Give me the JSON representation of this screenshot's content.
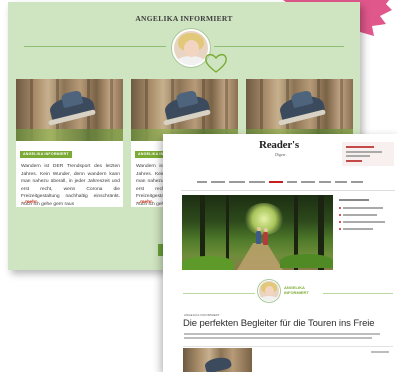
{
  "colors": {
    "accent_pink": "#e0578b",
    "panel_green": "#cfe4c0",
    "badge_green": "#7bab34",
    "more_red": "#c4381d",
    "nav_active_red": "#c81e1e"
  },
  "section": {
    "title": "ANGELIKA INFORMIERT"
  },
  "cards": [
    {
      "badge": "ANGELIKA INFORMIERT",
      "text": "Wandern ist DER Trendsport des letzten Jahres. Kein Wunder, denn wandern kann man nahezu überall, in jeder Jahreszeit und erst recht, wenn Corona die Freizeitgestaltung nachhaltig einschränkt. Auch ich gehe gern raus",
      "more": "...mehr"
    },
    {
      "badge": "ANGELIKA INFORMIERT",
      "text": "Wandern ist DER Trendsport des letzten Jahres. Kein Wunder, denn wandern kann man nahezu überall, in jeder Jahreszeit und erst recht, wenn Corona die Freizeitgestaltung nachhaltig einschränkt. Auch ich gehe gern raus",
      "more": "...mehr"
    },
    {
      "badge": "ANGELIKA INFORMIERT",
      "text": "Wandern ist DER Trendsport des letzten Jahres. Kein Wunder, denn wandern kann man nahezu überall, in jeder Jahreszeit und erst recht, wenn Corona die Freizeitgestaltung nachhaltig einschränkt. Auch ich gehe gern raus",
      "more": "...mehr"
    }
  ],
  "article": {
    "logo": "Reader's",
    "logo_sub": "Digest",
    "author_line1": "ANGELIKA",
    "author_line2": "INFORMIERT",
    "kicker": "ANGELIKA INFORMIERT",
    "title": "Die perfekten Begleiter für die Touren ins Freie"
  },
  "icons": {
    "heart": "heart-outline-icon",
    "avatar": "author-avatar"
  }
}
